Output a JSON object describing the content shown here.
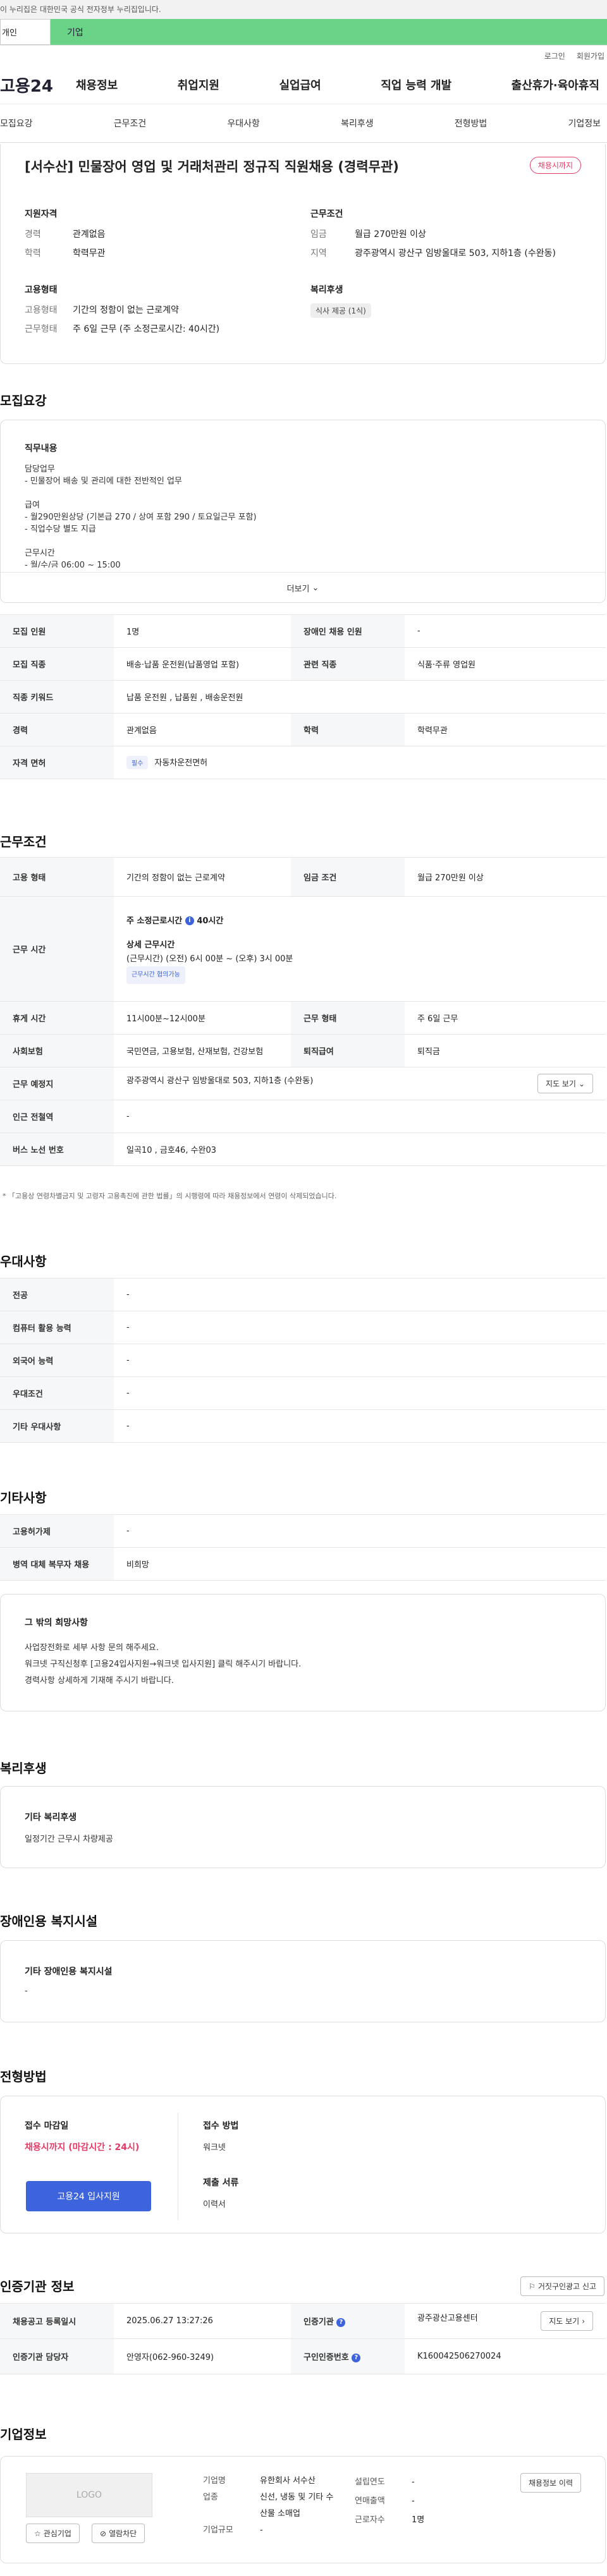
{
  "gov_bar": "이 누리집은 대한민국 공식 전자정부 누리집입니다.",
  "type_tabs": {
    "personal": "개인",
    "corp": "기업"
  },
  "util_links": [
    "로그인",
    "회원가입"
  ],
  "logo": "고용24",
  "gnb": [
    "채용정보",
    "취업지원",
    "실업급여",
    "직업 능력 개발",
    "출산휴가·육아휴직"
  ],
  "subnav": [
    "모집요강",
    "근무조건",
    "우대사항",
    "복리후생",
    "전형방법",
    "기업정보"
  ],
  "summary": {
    "title": "[서수산] 민물장어 영업 및 거래처관리 정규직 직원채용 (경력무관)",
    "badge": "채용시까지",
    "support_title": "지원자격",
    "support": [
      {
        "k": "경력",
        "v": "관계없음"
      },
      {
        "k": "학력",
        "v": "학력무관"
      }
    ],
    "work_title": "근무조건",
    "work": [
      {
        "k": "임금",
        "v": "월급 270만원 이상"
      },
      {
        "k": "지역",
        "v": "광주광역시 광산구 임방울대로 503, 지하1층 (수완동)"
      }
    ],
    "emp_title": "고용형태",
    "emp": [
      {
        "k": "고용형태",
        "v": "기간의 정함이 없는 근로계약"
      },
      {
        "k": "근무형태",
        "v": "주 6일 근무 (주 소정근로시간: 40시간)"
      }
    ],
    "welfare_title": "복리후생",
    "welfare_chip": "식사 제공 (1식)"
  },
  "recruit": {
    "title": "모집요강",
    "job_title": "직무내용",
    "job_lines": [
      "담당업무",
      "- 민물장어 배송 및 관리에 대한 전반적인 업무",
      "",
      "급여",
      "- 월290만원상당 (기본급 270 / 상여 포함 290 / 토요일근무 포함)",
      "- 직업수당 별도 지급",
      "",
      "근무시간",
      "- 월/수/금 06:00 ~ 15:00"
    ],
    "more": "더보기",
    "rows": [
      {
        "k1": "모집 인원",
        "v1": "1명",
        "k2": "장애인 채용 인원",
        "v2": "-"
      },
      {
        "k1": "모집 직종",
        "v1": "배송·납품 운전원(납품영업 포함)",
        "k2": "관련 직종",
        "v2": "식품·주류 영업원"
      },
      {
        "k1": "직종 키워드",
        "v1": "납품 운전원 , 납품원 , 배송운전원"
      },
      {
        "k1": "경력",
        "v1": "관계없음",
        "k2": "학력",
        "v2": "학력무관"
      },
      {
        "k1": "자격 면허",
        "tag": "필수",
        "v1": "자동차운전면허"
      }
    ]
  },
  "work_cond": {
    "title": "근무조건",
    "emp_k": "고용 형태",
    "emp_v": "기간의 정함이 없는 근로계약",
    "wage_k": "임금 조건",
    "wage_v": "월급 270만원 이상",
    "time_k": "근무 시간",
    "time_main": "주 소정근로시간",
    "time_hours": "40시간",
    "time_detail_title": "상세 근무시간",
    "time_detail": "(근무시간) (오전) 6시 00분 ~ (오후) 3시 00분",
    "time_tag": "근무시간 협의가능",
    "rest_k": "휴게 시간",
    "rest_v": "11시00분~12시00분",
    "type_k": "근무 형태",
    "type_v": "주 6일 근무",
    "ins_k": "사회보험",
    "ins_v": "국민연금, 고용보험, 산재보험, 건강보험",
    "sev_k": "퇴직급여",
    "sev_v": "퇴직금",
    "place_k": "근무 예정지",
    "place_v": "광주광역시 광산구 임방울대로 503, 지하1층 (수완동)",
    "map_btn": "지도 보기",
    "subway_k": "인근 전철역",
    "subway_v": "-",
    "bus_k": "버스 노선 번호",
    "bus_v": "일곡10 , 금호46, 수완03",
    "note": "* 「고용상 연령차별금지 및 고령자 고용촉진에 관한 법률」의 시행령에 따라 채용정보에서 연령이 삭제되었습니다."
  },
  "pref": {
    "title": "우대사항",
    "rows": [
      {
        "k": "전공",
        "v": "-"
      },
      {
        "k": "컴퓨터 활용 능력",
        "v": "-"
      },
      {
        "k": "외국어 능력",
        "v": "-"
      },
      {
        "k": "우대조건",
        "v": "-"
      },
      {
        "k": "기타 우대사항",
        "v": "-"
      }
    ]
  },
  "etc": {
    "title": "기타사항",
    "rows": [
      {
        "k": "고용허가제",
        "v": "-"
      },
      {
        "k": "병역 대체 복무자 채용",
        "v": "비희망"
      }
    ],
    "box_title": "그 밖의 희망사항",
    "box_lines": [
      "사업장전화로 세부 사항 문의 해주세요.",
      "워크넷 구직신청후 [고용24입사지원→워크넷 입사지원] 클릭 해주시기 바랍니다.",
      "경력사항 상세하게 기재해 주시기 바랍니다."
    ]
  },
  "welfare": {
    "title": "복리후생",
    "box_title": "기타 복리후생",
    "box_text": "일정기간 근무시 차량제공"
  },
  "disab": {
    "title": "장애인용 복지시설",
    "box_title": "기타 장애인용 복지시설",
    "box_text": "-"
  },
  "selection": {
    "title": "전형방법",
    "deadline_title": "접수 마감일",
    "deadline": "채용시까지 (마감시간 : 24시)",
    "apply_btn": "고용24 입사지원",
    "method_title": "접수 방법",
    "method": "워크넷",
    "docs_title": "제출 서류",
    "docs": "이력서"
  },
  "cert": {
    "title": "인증기관 정보",
    "report_btn": "거짓구인광고 신고",
    "reg_k": "채용공고 등록일시",
    "reg_v": "2025.06.27 13:27:26",
    "org_k": "인증기관",
    "org_v": "광주광산고용센터",
    "map_btn": "지도 보기",
    "mgr_k": "인증기관 담당자",
    "mgr_v": "안영자(062-960-3249)",
    "id_k": "구인인증번호",
    "id_v": "K160042506270024"
  },
  "company": {
    "title": "기업정보",
    "logo": "LOGO",
    "fav_btn": "관심기업",
    "block_btn": "열람차단",
    "k1": "기업명",
    "v1": "유한회사 서수산",
    "k2": "업종",
    "v2": "신선, 냉동 및 기타 수산물 소매업",
    "k3": "기업규모",
    "v3": "-",
    "k4": "설립연도",
    "v4": "-",
    "k5": "연매출액",
    "v5": "-",
    "k6": "근로자수",
    "v6": "1명",
    "list_btn": "채용정보 이력"
  },
  "colors": {
    "accent": "#3d63dd",
    "brand_green": "#6ad387",
    "deadline_red": "#e53a66"
  }
}
